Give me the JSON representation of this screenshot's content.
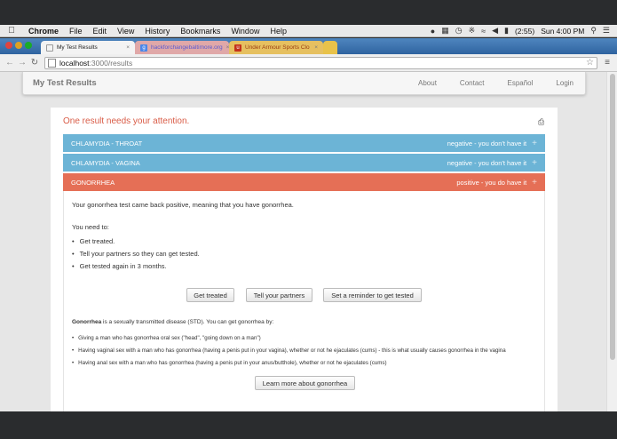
{
  "menubar": {
    "app": "Chrome",
    "items": [
      "File",
      "Edit",
      "View",
      "History",
      "Bookmarks",
      "Window",
      "Help"
    ],
    "battery": "(2:55)",
    "clock": "Sun 4:00 PM"
  },
  "browser": {
    "tabs": [
      {
        "title": "My Test Results"
      },
      {
        "title": "hackforchangebaltimore.org"
      },
      {
        "title": "Under Armour Sports Clo"
      }
    ],
    "url_host": "localhost",
    "url_path": ":3000/results"
  },
  "navbar": {
    "brand": "My Test Results",
    "links": [
      "About",
      "Contact",
      "Español",
      "Login"
    ]
  },
  "page": {
    "attention": "One result needs your attention.",
    "results": [
      {
        "test": "CHLAMYDIA - THROAT",
        "status": "negative - you don't have it"
      },
      {
        "test": "CHLAMYDIA - VAGINA",
        "status": "negative - you don't have it"
      },
      {
        "test": "GONORRHEA",
        "status": "positive - you do have it"
      }
    ],
    "detail": {
      "intro": "Your gonorrhea test came back positive, meaning that you have gonorrhea.",
      "need_to": "You need to:",
      "steps": [
        "Get treated.",
        "Tell your partners so they can get tested.",
        "Get tested again in 3 months."
      ],
      "buttons": {
        "treated": "Get treated",
        "partners": "Tell your partners",
        "reminder": "Set a reminder to get tested"
      },
      "about_term": "Gonorrhea",
      "about_rest": " is a sexually transmitted disease (STD). You can get gonorrhea by:",
      "facts": [
        "Giving a man who has gonorrhea oral sex (\"head\", \"going down on a man\")",
        "Having vaginal sex with a man who has gonorrhea (having a penis put in your vagina), whether or not he ejaculates (cums) - this is what usually causes gonorrhea in the vagina",
        "Having anal sex with a man who has gonorrhea (having a penis put in your anus/butthole), whether or not he ejaculates (cums)"
      ],
      "learn_more": "Learn more about gonorrhea"
    }
  },
  "colors": {
    "negative": "#6cb4d6",
    "positive": "#e56f56",
    "attention": "#d95c47"
  }
}
